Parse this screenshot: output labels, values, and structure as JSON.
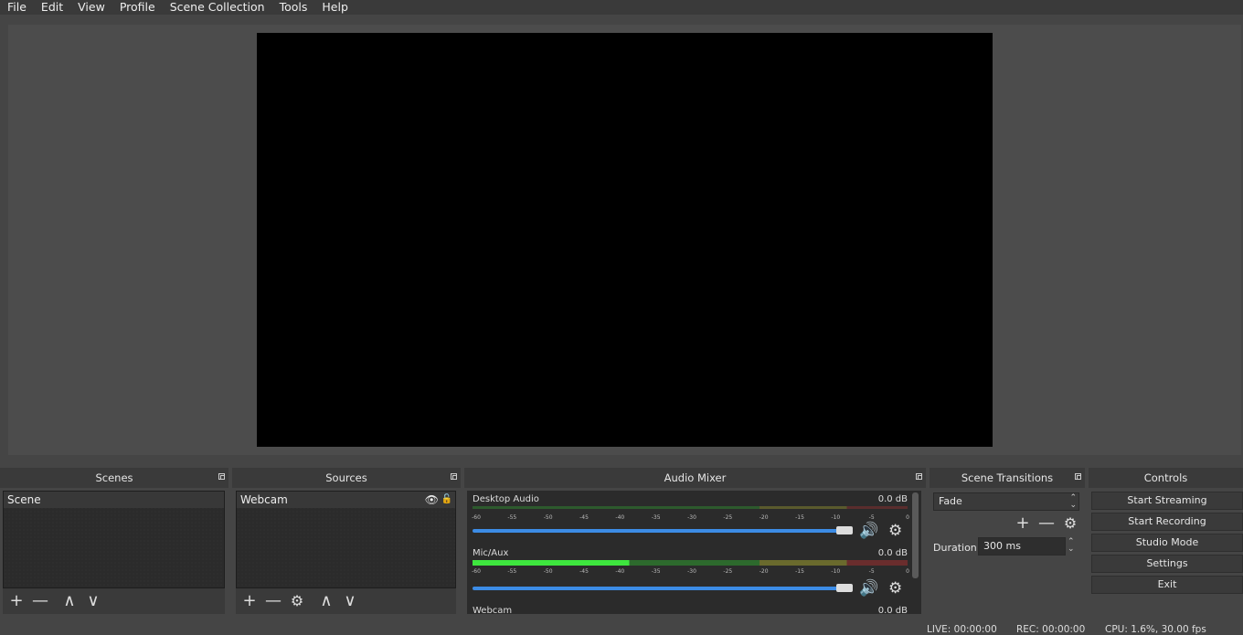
{
  "menu": [
    "File",
    "Edit",
    "View",
    "Profile",
    "Scene Collection",
    "Tools",
    "Help"
  ],
  "docks": {
    "scenes": {
      "title": "Scenes",
      "items": [
        "Scene"
      ]
    },
    "sources": {
      "title": "Sources",
      "items": [
        "Webcam"
      ]
    },
    "mixer": {
      "title": "Audio Mixer"
    },
    "transitions": {
      "title": "Scene Transitions",
      "selected": "Fade",
      "duration_label": "Duration",
      "duration_value": "300 ms"
    },
    "controls": {
      "title": "Controls",
      "buttons": [
        "Start Streaming",
        "Start Recording",
        "Studio Mode",
        "Settings",
        "Exit"
      ]
    }
  },
  "mixer_channels": [
    {
      "name": "Desktop Audio",
      "db": "0.0 dB",
      "active": false
    },
    {
      "name": "Mic/Aux",
      "db": "0.0 dB",
      "active": true
    },
    {
      "name": "Webcam",
      "db": "0.0 dB",
      "active": false
    }
  ],
  "meter_ticks": [
    "-60",
    "-55",
    "-50",
    "-45",
    "-40",
    "-35",
    "-30",
    "-25",
    "-20",
    "-15",
    "-10",
    "-5",
    "0"
  ],
  "status": {
    "live": "LIVE: 00:00:00",
    "rec": "REC: 00:00:00",
    "cpu": "CPU: 1.6%, 30.00 fps"
  },
  "icons": {
    "add": "+",
    "remove": "—",
    "up": "∧",
    "down": "∨",
    "gear": "⚙",
    "speaker": "🔊",
    "eye": "👁",
    "lock": "🔓"
  }
}
